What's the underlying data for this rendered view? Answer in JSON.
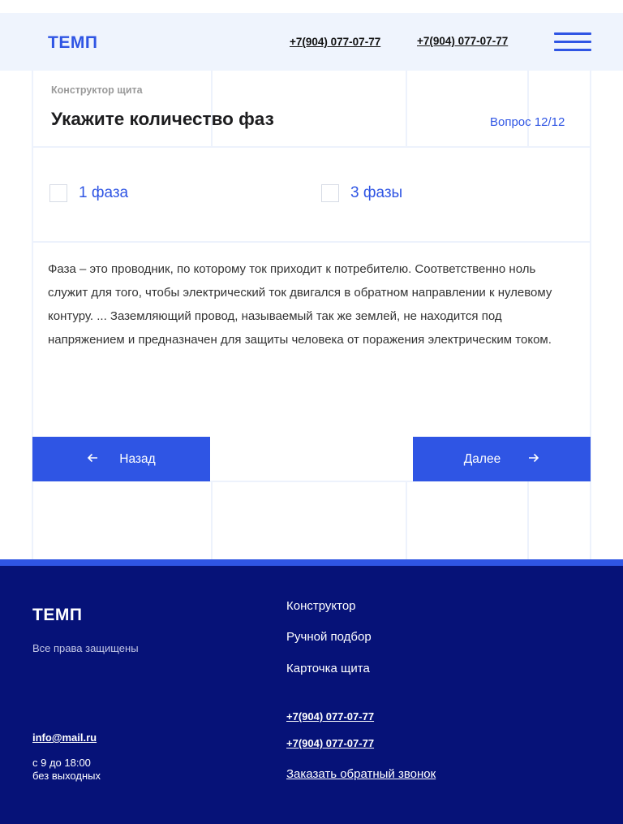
{
  "header": {
    "logo": "ТЕМП",
    "phone_1": "+7(904) 077-07-77",
    "phone_2": "+7(904) 077-07-77"
  },
  "question": {
    "breadcrumb": "Конструктор щита",
    "title": "Укажите количество фаз",
    "counter": "Вопрос 12/12",
    "options": [
      {
        "label": "1 фаза",
        "checked": false
      },
      {
        "label": "3 фазы",
        "checked": false
      }
    ],
    "description": "Фаза – это проводник, по которому ток приходит к потребителю. Соответственно ноль служит для того, чтобы электрический ток двигался в обратном направлении к нулевому контуру. ... Заземляющий провод, называемый так же землей, не находится под напряжением и предназначен для защиты человека от поражения электрическим током."
  },
  "nav": {
    "back_label": "Назад",
    "next_label": "Далее",
    "back_icon": "arrow-left-icon",
    "next_icon": "arrow-right-icon"
  },
  "footer": {
    "logo": "ТЕМП",
    "rights": "Все права защищены",
    "menu": [
      "Конструктор",
      "Ручной подбор",
      "Карточка щита"
    ],
    "phone_1": "+7(904) 077-07-77",
    "phone_2": "+7(904) 077-07-77",
    "email": "info@mail.ru",
    "hours_line_1": "с 9 до 18:00",
    "hours_line_2": "без выходных",
    "callback": "Заказать обратный звонок"
  },
  "colors": {
    "accent": "#2f55e4",
    "footer_bg": "#061278",
    "header_bg": "#eff4fd"
  }
}
